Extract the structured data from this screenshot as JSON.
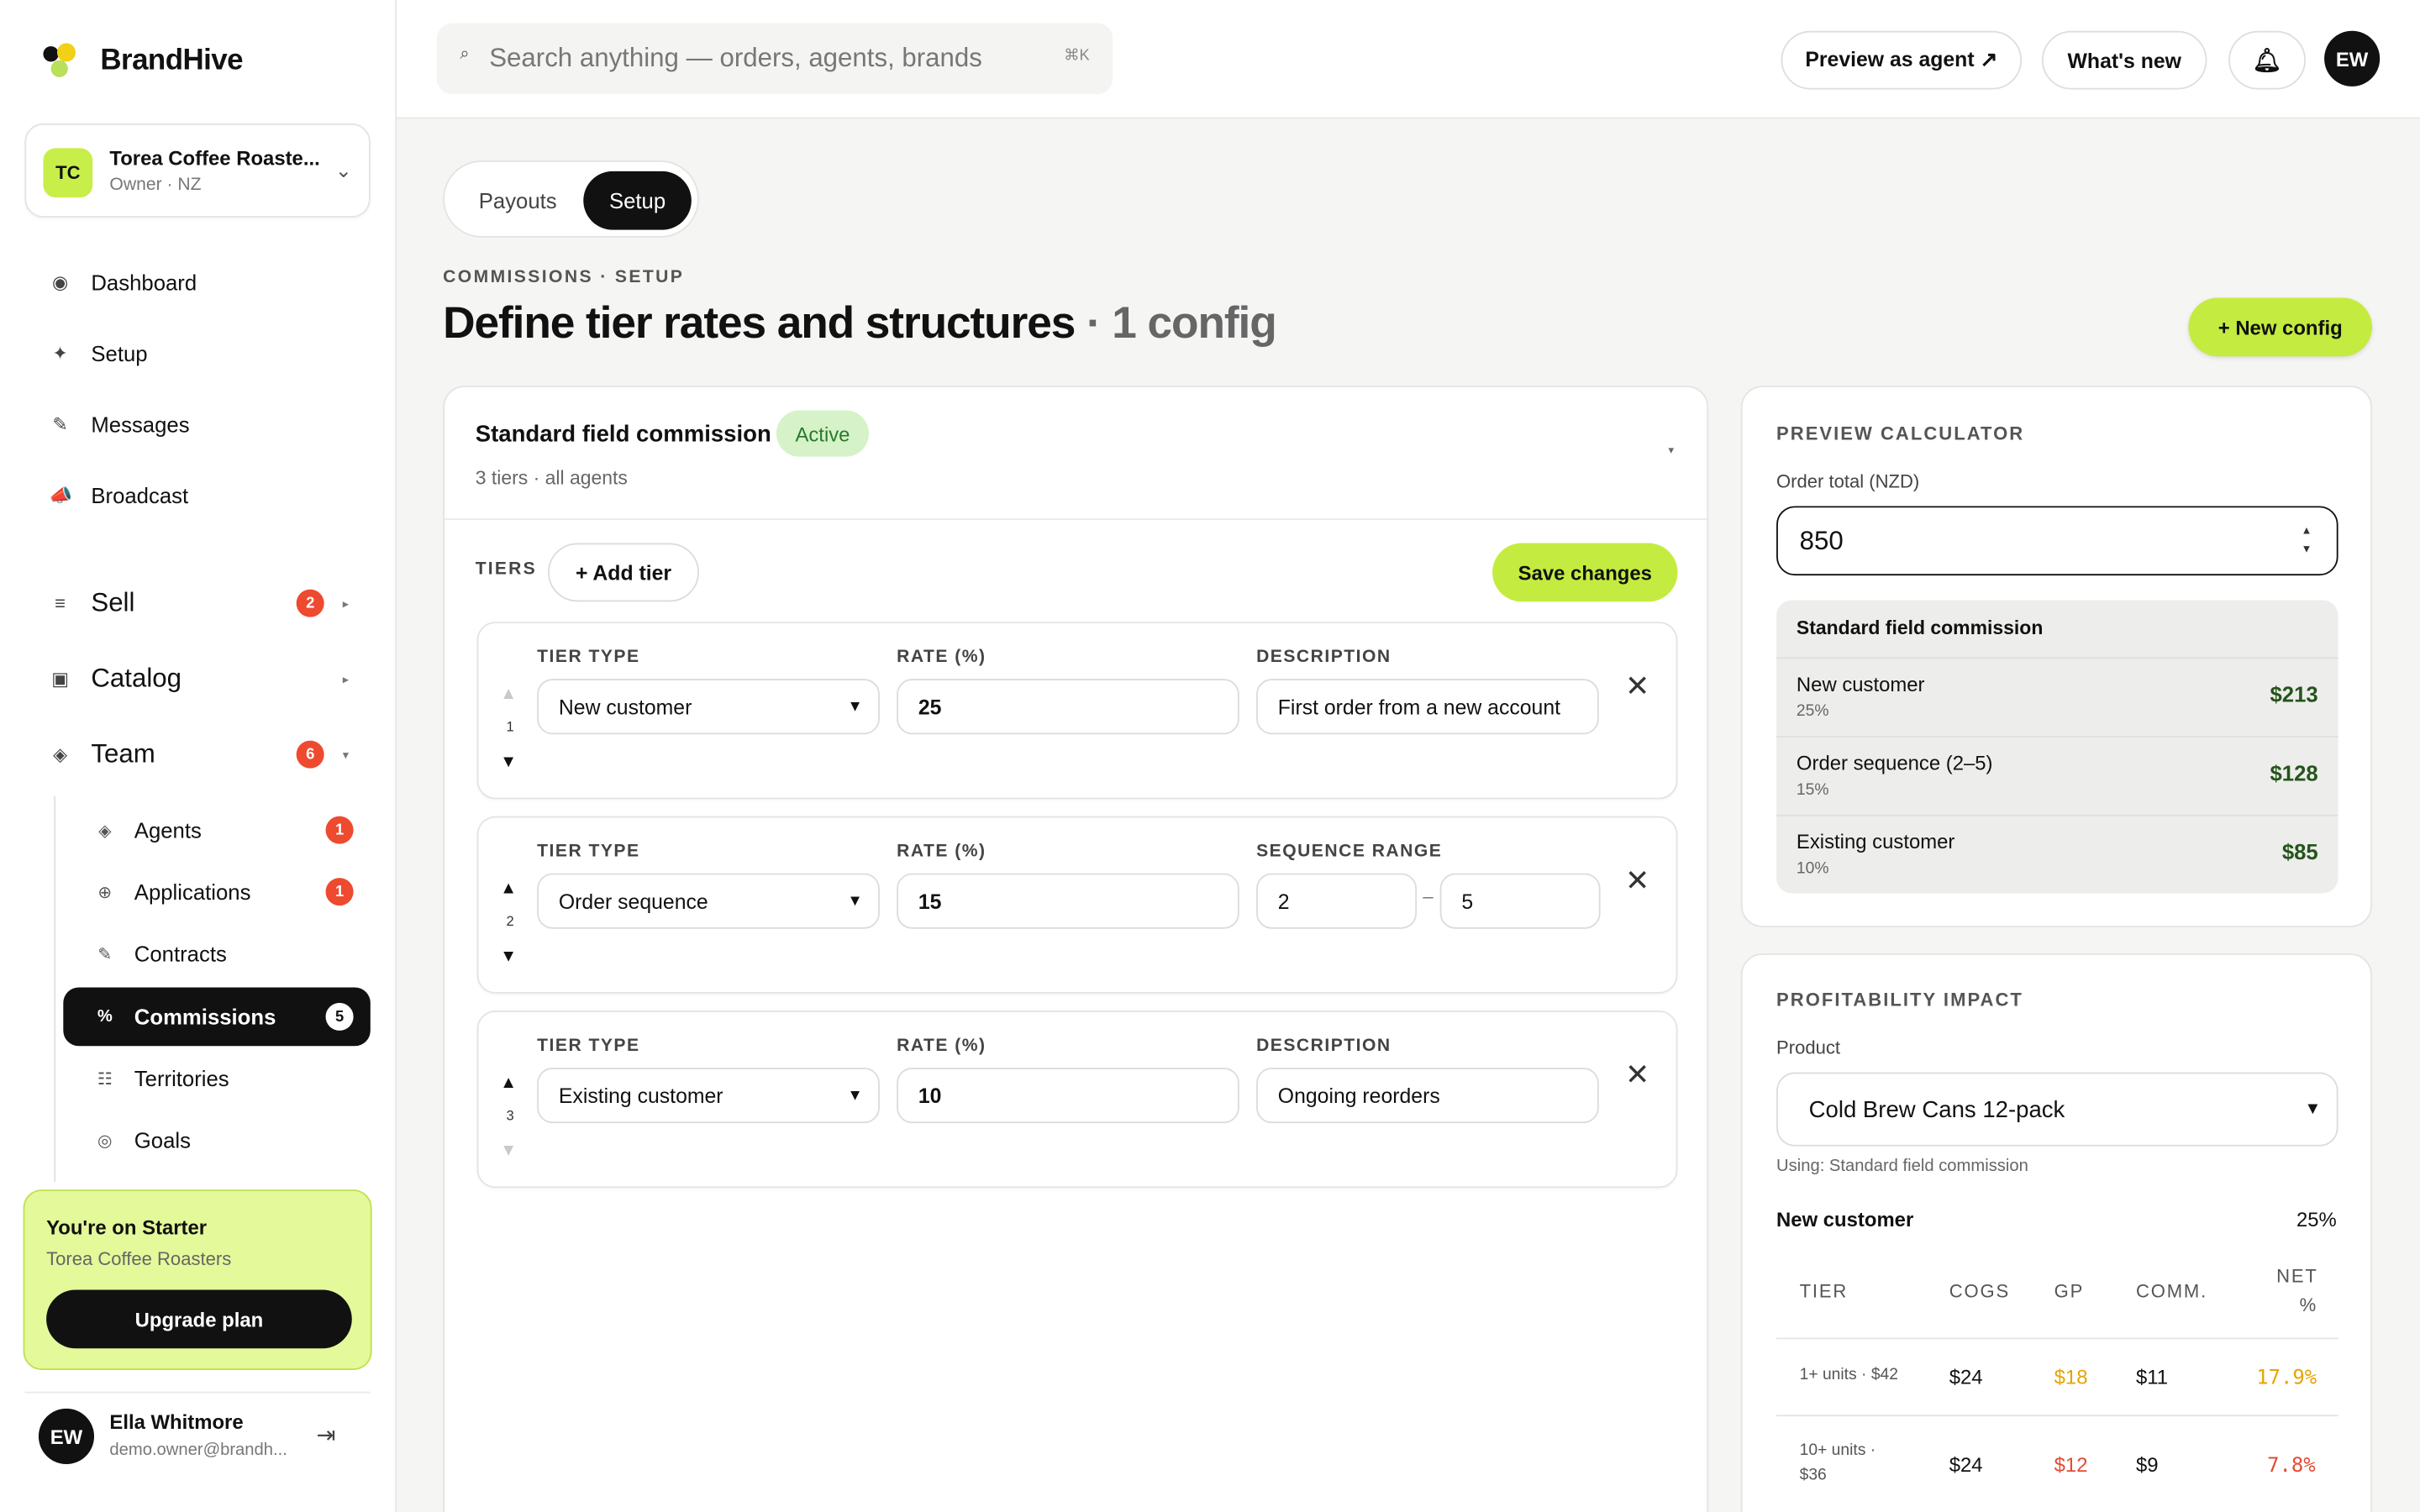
{
  "brand": {
    "name": "BrandHive"
  },
  "org": {
    "initials": "TC",
    "name": "Torea Coffee Roaste...",
    "role": "Owner · NZ"
  },
  "nav": [
    {
      "label": "Dashboard",
      "icon": "dashboard-icon"
    },
    {
      "label": "Setup",
      "icon": "sparkle-icon"
    },
    {
      "label": "Messages",
      "icon": "pencil-icon"
    },
    {
      "label": "Broadcast",
      "icon": "megaphone-icon"
    }
  ],
  "sections": [
    {
      "label": "Sell",
      "count": "2"
    },
    {
      "label": "Catalog",
      "count": ""
    },
    {
      "label": "Team",
      "count": "6"
    }
  ],
  "team_items": [
    {
      "label": "Agents",
      "count": "1"
    },
    {
      "label": "Applications",
      "count": "1"
    },
    {
      "label": "Contracts",
      "count": ""
    },
    {
      "label": "Commissions",
      "count": "5"
    },
    {
      "label": "Territories",
      "count": ""
    },
    {
      "label": "Goals",
      "count": ""
    }
  ],
  "plan": {
    "title": "You're on Starter",
    "org": "Torea Coffee Roasters",
    "button": "Upgrade plan"
  },
  "user": {
    "initials": "EW",
    "name": "Ella Whitmore",
    "email": "demo.owner@brandh..."
  },
  "header": {
    "search_placeholder": "Search anything — orders, agents, brands",
    "shortcut": "⌘K",
    "preview_agent": "Preview as agent ↗",
    "whats_new": "What's new",
    "avatar": "EW"
  },
  "tabs": [
    "Payouts",
    "Setup"
  ],
  "page": {
    "eyebrow": "COMMISSIONS · SETUP",
    "title": "Define tier rates and structures",
    "title_count": "· 1 config",
    "new_config": "+ New config"
  },
  "config": {
    "name": "Standard field commission",
    "status": "Active",
    "meta": "3 tiers · all agents",
    "tiers_label": "TIERS",
    "add_tier": "+ Add tier",
    "save": "Save changes",
    "labels": {
      "tier_type": "TIER TYPE",
      "rate": "RATE (%)",
      "description": "DESCRIPTION",
      "sequence_range": "SEQUENCE RANGE"
    },
    "tiers": [
      {
        "num": "1",
        "type": "New customer",
        "rate": "25",
        "description": "First order from a new account"
      },
      {
        "num": "2",
        "type": "Order sequence",
        "rate": "15",
        "range_from": "2",
        "range_to": "5"
      },
      {
        "num": "3",
        "type": "Existing customer",
        "rate": "10",
        "description": "Ongoing reorders"
      }
    ]
  },
  "calculator": {
    "caption": "PREVIEW CALCULATOR",
    "order_label": "Order total (NZD)",
    "order_total": "850",
    "config_name": "Standard field commission",
    "rows": [
      {
        "label": "New customer",
        "pct": "25%",
        "value": "$213"
      },
      {
        "label": "Order sequence (2–5)",
        "pct": "15%",
        "value": "$128"
      },
      {
        "label": "Existing customer",
        "pct": "10%",
        "value": "$85"
      }
    ]
  },
  "profitability": {
    "caption": "PROFITABILITY IMPACT",
    "product_label": "Product",
    "product": "Cold Brew Cans 12-pack",
    "using": "Using: Standard field commission",
    "tier_name": "New customer",
    "tier_pct": "25%",
    "headers": [
      "TIER",
      "COGS",
      "GP",
      "COMM.",
      "NET",
      "%"
    ],
    "rows": [
      {
        "tier": "1+ units · $42",
        "cogs": "$24",
        "gp": "$18",
        "comm": "$11",
        "net": "17.9%"
      },
      {
        "tier_line1": "10+ units ·",
        "tier_line2": "$36",
        "cogs": "$24",
        "gp": "$12",
        "comm": "$9",
        "net": "7.8%"
      }
    ]
  },
  "colors": {
    "accent": "#c4ec40",
    "badge_red": "#ee4a2f",
    "gp_orange": "#e6a400",
    "net_red": "#e34b33",
    "money_green": "#24541b"
  }
}
